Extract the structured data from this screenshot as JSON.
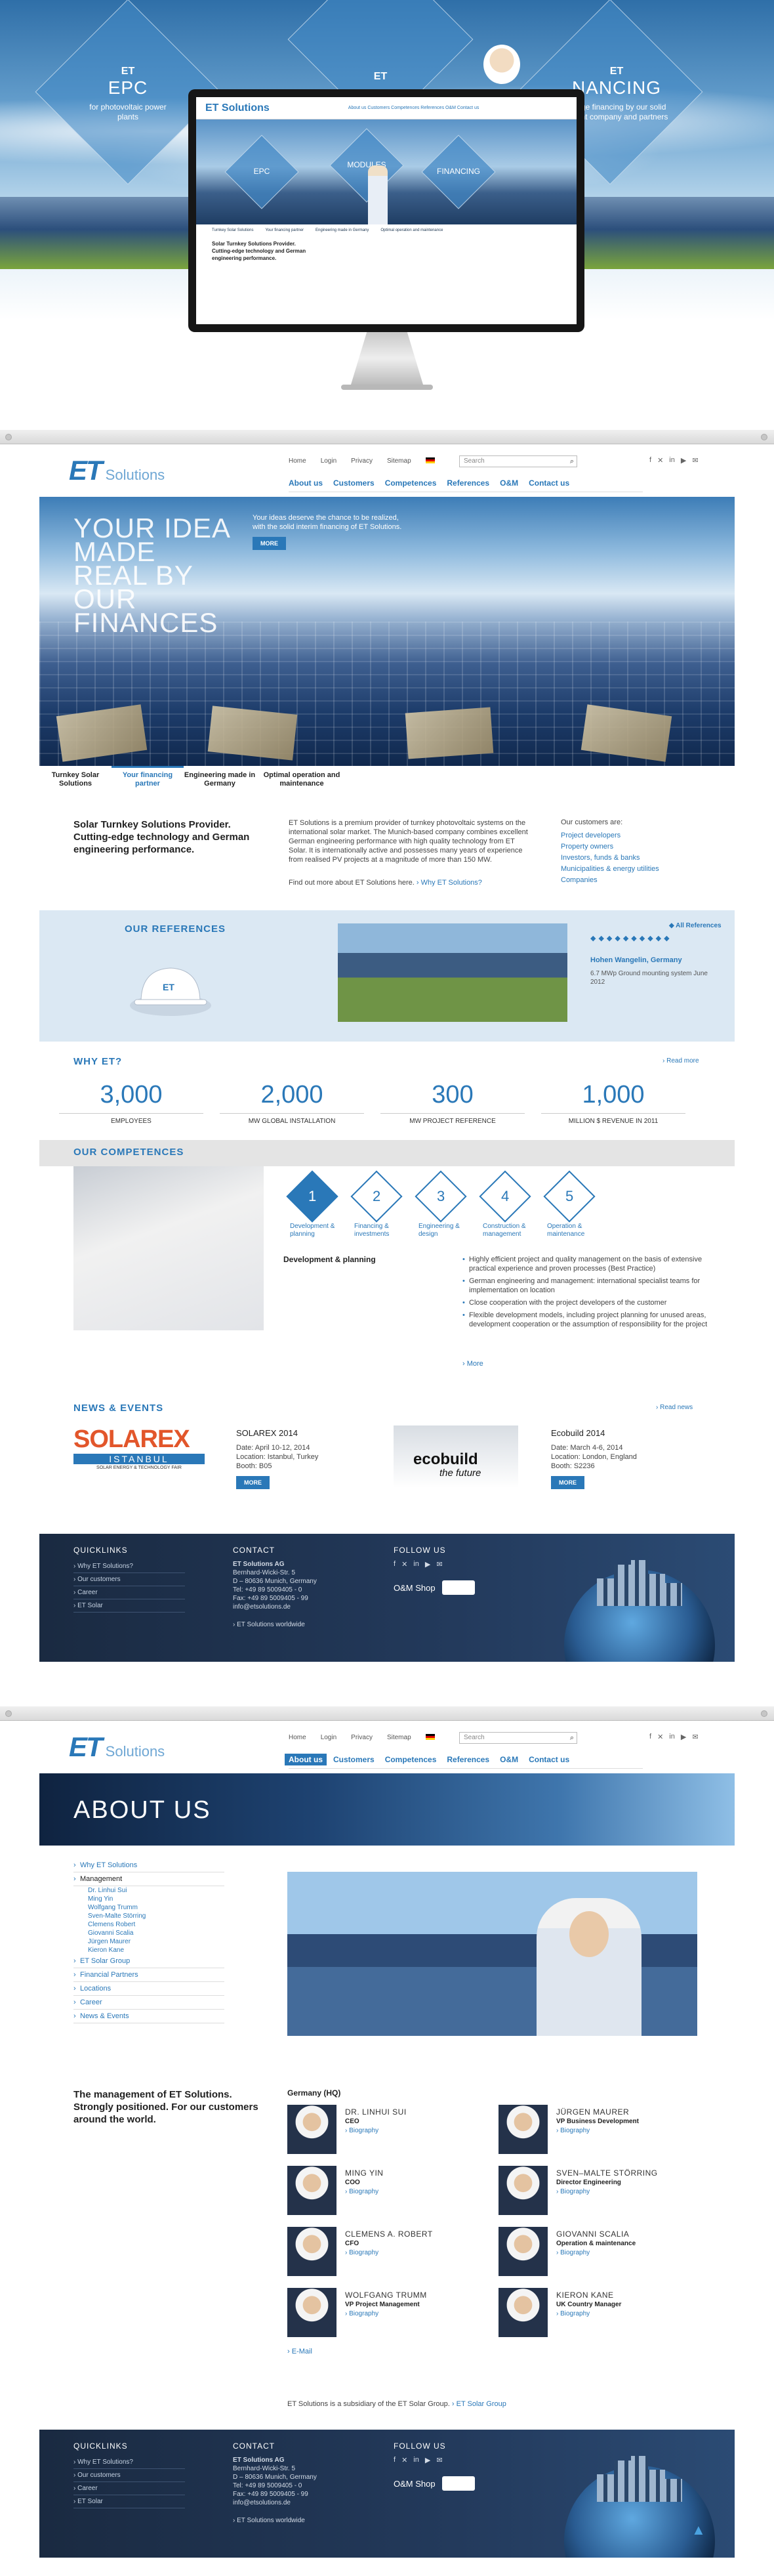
{
  "hero": {
    "diamonds": [
      {
        "logo": "ET",
        "title": "EPC",
        "text": "for photovoltaic power plants"
      },
      {
        "logo": "ET",
        "title": "",
        "text": ""
      },
      {
        "logo": "ET",
        "title": "NANCING",
        "text": "Bridge financing by our solid parent company and partners"
      }
    ],
    "monitor": {
      "logo": "ET Solutions",
      "nav": "About us  Customers  Competences  References  O&M  Contact us",
      "diamonds": [
        "EPC",
        "MODULES",
        "FINANCING"
      ],
      "tabs": [
        "Turnkey Solar Solutions",
        "Your financing partner",
        "Engineering made in Germany",
        "Optimal operation and maintenance"
      ],
      "tagline": "Solar Turnkey Solutions Provider. Cutting-edge technology and German engineering performance."
    }
  },
  "site": {
    "logo_et": "ET",
    "logo_sol": "Solutions",
    "toplinks": [
      "Home",
      "Login",
      "Privacy",
      "Sitemap"
    ],
    "search_placeholder": "Search",
    "social": [
      "f",
      "✕",
      "in",
      "▶",
      "✉"
    ],
    "nav": [
      "About us",
      "Customers",
      "Competences",
      "References",
      "O&M",
      "Contact us"
    ]
  },
  "home": {
    "banner_head": "YOUR IDEA MADE REAL BY OUR FINANCES",
    "banner_lead": "Your ideas deserve the chance to be realized, with the solid interim financing of ET Solutions.",
    "more": "MORE",
    "tabs": [
      "Turnkey Solar Solutions",
      "Your financing partner",
      "Engineering made in Germany",
      "Optimal operation and maintenance"
    ],
    "tagline": "Solar Turnkey Solutions Provider. Cutting-edge technology and German engineering performance.",
    "intro_text": "ET Solutions is a premium provider of turnkey photovoltaic systems on the international solar market. The Munich-based company combines excellent German engineering performance with high quality technology from ET Solar. It is internationally active and possesses many years of experience from realised PV projects at a magnitude of more than 150 MW.",
    "findout": "Find out more about ET Solutions here.",
    "findout_link": "› Why ET Solutions?",
    "customers_head": "Our customers are:",
    "customers": [
      "Project developers",
      "Property owners",
      "Investors, funds & banks",
      "Municipalities & energy utilities",
      "Companies"
    ],
    "refs": {
      "title": "OUR REFERENCES",
      "all": "◆ All References",
      "dots": "◆◆◆◆◆◆◆◆◆◆",
      "place": "Hohen Wangelin, Germany",
      "desc": "6.7 MWp Ground mounting system June 2012"
    },
    "why": {
      "title": "WHY ET?",
      "readmore": "› Read more",
      "stats": [
        {
          "num": "3,000",
          "lab": "EMPLOYEES"
        },
        {
          "num": "2,000",
          "lab": "MW GLOBAL INSTALLATION"
        },
        {
          "num": "300",
          "lab": "MW PROJECT REFERENCE"
        },
        {
          "num": "1,000",
          "lab": "MILLION $ REVENUE IN 2011"
        }
      ]
    },
    "competences": {
      "title": "OUR COMPETENCES",
      "steps": [
        {
          "n": "1",
          "lab": "Development & planning"
        },
        {
          "n": "2",
          "lab": "Financing & investments"
        },
        {
          "n": "3",
          "lab": "Engineering & design"
        },
        {
          "n": "4",
          "lab": "Construction & management"
        },
        {
          "n": "5",
          "lab": "Operation & maintenance"
        }
      ],
      "detail_title": "Development & planning",
      "bullets": [
        "Highly efficient project and quality management on the basis of extensive practical experience and proven processes (Best Practice)",
        "German engineering and management: international specialist teams for implementation on location",
        "Close cooperation with the project developers of the customer",
        "Flexible development models, including project planning for unused areas, development cooperation or the assumption of responsibility for the project"
      ],
      "more": "› More"
    },
    "news": {
      "title": "NEWS & EVENTS",
      "readnew": "› Read news",
      "events": [
        {
          "logo": "SOLAREX",
          "logo2": "ISTANBUL",
          "logo3": "SOLAR ENERGY & TECHNOLOGY FAIR",
          "title": "SOLAREX 2014",
          "date": "Date: April 10-12, 2014",
          "loc": "Location: Istanbul, Turkey",
          "booth": "Booth: B05",
          "more": "MORE"
        },
        {
          "logo": "ecobuild",
          "logo2": "the future",
          "title": "Ecobuild 2014",
          "date": "Date: March 4-6, 2014",
          "loc": "Location: London, England",
          "booth": "Booth: S2236",
          "more": "MORE"
        }
      ]
    }
  },
  "footer": {
    "quick_h": "QUICKLINKS",
    "quick": [
      "› Why ET Solutions?",
      "› Our customers",
      "› Career",
      "› ET Solar"
    ],
    "contact_h": "CONTACT",
    "company": "ET Solutions AG",
    "street": "Bernhard-Wicki-Str. 5",
    "city": "D – 80636 Munich, Germany",
    "tel": "Tel: +49 89 5009405 - 0",
    "fax": "Fax: +49 89 5009405 - 99",
    "mail": "info@etsolutions.de",
    "worldwide": "› ET Solutions worldwide",
    "follow_h": "FOLLOW US",
    "social": [
      "f",
      "✕",
      "in",
      "▶",
      "✉"
    ],
    "om": "O&M Shop"
  },
  "about": {
    "banner": "ABOUT US",
    "leftnav": [
      {
        "t": "Why ET Solutions",
        "k": "main"
      },
      {
        "t": "Management",
        "k": "active"
      },
      {
        "t": "Dr. Linhui Sui",
        "k": "sub"
      },
      {
        "t": "Ming Yin",
        "k": "sub"
      },
      {
        "t": "Wolfgang Trumm",
        "k": "sub"
      },
      {
        "t": "Sven-Malte Störring",
        "k": "sub"
      },
      {
        "t": "Clemens Robert",
        "k": "sub"
      },
      {
        "t": "Giovanni Scalia",
        "k": "sub"
      },
      {
        "t": "Jürgen Maurer",
        "k": "sub"
      },
      {
        "t": "Kieron Kane",
        "k": "sub"
      },
      {
        "t": "ET Solar Group",
        "k": "main"
      },
      {
        "t": "Financial Partners",
        "k": "main"
      },
      {
        "t": "Locations",
        "k": "main"
      },
      {
        "t": "Career",
        "k": "main"
      },
      {
        "t": "News & Events",
        "k": "main"
      }
    ],
    "tagline": "The management of ET Solutions. Strongly positioned. For our customers around the world.",
    "team_head": "Germany (HQ)",
    "team": [
      {
        "name": "DR. LINHUI SUI",
        "role": "CEO",
        "bio": "› Biography"
      },
      {
        "name": "JÜRGEN MAURER",
        "role": "VP Business Development",
        "bio": "› Biography"
      },
      {
        "name": "MING YIN",
        "role": "COO",
        "bio": "› Biography"
      },
      {
        "name": "SVEN–MALTE STÖRRING",
        "role": "Director Engineering",
        "bio": "› Biography"
      },
      {
        "name": "CLEMENS A. ROBERT",
        "role": "CFO",
        "bio": "› Biography"
      },
      {
        "name": "GIOVANNI SCALIA",
        "role": "Operation & maintenance",
        "bio": "› Biography"
      },
      {
        "name": "WOLFGANG TRUMM",
        "role": "VP Project Management",
        "bio": "› Biography"
      },
      {
        "name": "KIERON KANE",
        "role": "UK Country Manager",
        "bio": "› Biography"
      }
    ],
    "email": "› E-Mail",
    "subsid": "ET Solutions is a subsidiary of the ET Solar Group.",
    "subsid_link": "› ET Solar Group"
  }
}
